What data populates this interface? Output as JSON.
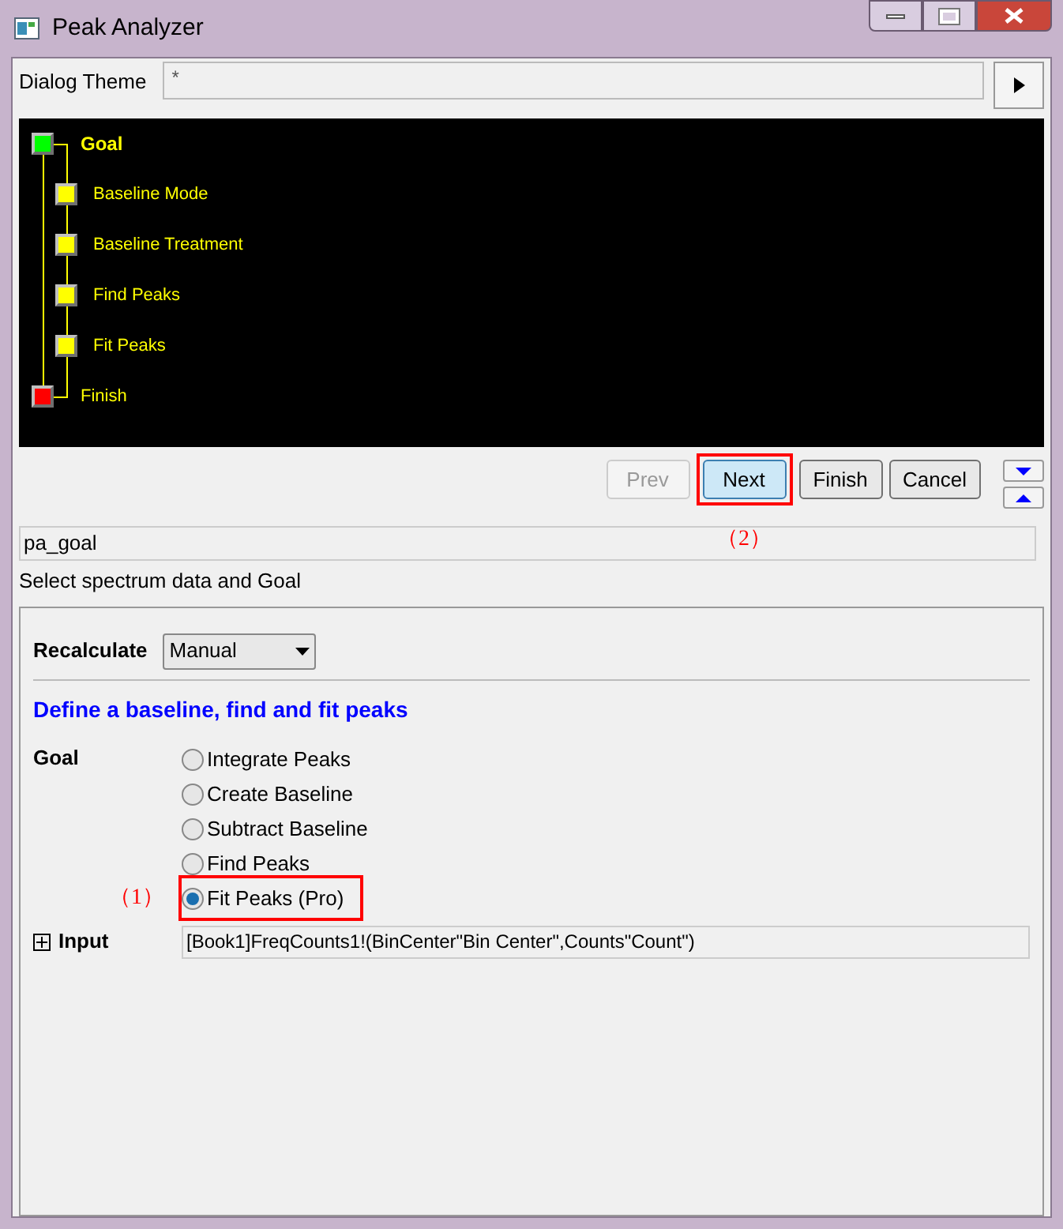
{
  "window": {
    "title": "Peak Analyzer"
  },
  "theme": {
    "label": "Dialog Theme",
    "value": "*"
  },
  "steps": [
    {
      "label": "Goal",
      "color": "#00ff00",
      "selected": true,
      "children": [
        {
          "label": "Baseline Mode",
          "color": "#ffff00",
          "selected": false
        },
        {
          "label": "Baseline Treatment",
          "color": "#ffff00",
          "selected": false
        },
        {
          "label": "Find Peaks",
          "color": "#ffff00",
          "selected": false
        },
        {
          "label": "Fit Peaks",
          "color": "#ffff00",
          "selected": false
        }
      ]
    },
    {
      "label": "Finish",
      "color": "#ff0000",
      "selected": false
    }
  ],
  "nav_buttons": [
    {
      "label": "Prev",
      "disabled": true,
      "focused": false,
      "highlighted": false
    },
    {
      "label": "Next",
      "disabled": false,
      "focused": true,
      "highlighted": true,
      "annotation": "（2）"
    },
    {
      "label": "Finish",
      "disabled": false,
      "focused": false,
      "highlighted": false
    },
    {
      "label": "Cancel",
      "disabled": false,
      "focused": false,
      "highlighted": false
    }
  ],
  "page_name": "pa_goal",
  "page_description": "Select spectrum data and Goal",
  "recalculate": {
    "label": "Recalculate",
    "value": "Manual"
  },
  "heading": "Define a baseline, find and fit peaks",
  "goal": {
    "label": "Goal",
    "options": [
      {
        "label": "Integrate Peaks",
        "selected": false,
        "highlighted": false
      },
      {
        "label": "Create Baseline",
        "selected": false,
        "highlighted": false
      },
      {
        "label": "Subtract Baseline",
        "selected": false,
        "highlighted": false
      },
      {
        "label": "Find Peaks",
        "selected": false,
        "highlighted": false
      },
      {
        "label": "Fit Peaks (Pro)",
        "selected": true,
        "highlighted": true,
        "annotation": "（1）"
      }
    ]
  },
  "input": {
    "label": "Input",
    "expanded": false,
    "value": "[Book1]FreqCounts1!(BinCenter\"Bin Center\",Counts\"Count\")"
  }
}
